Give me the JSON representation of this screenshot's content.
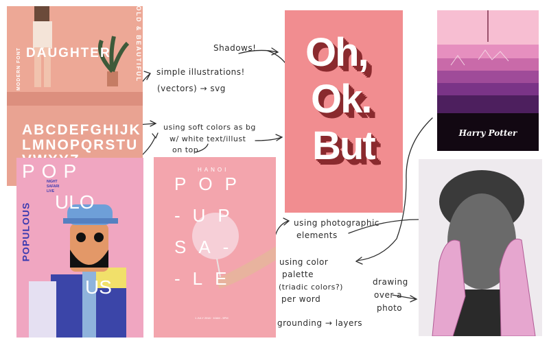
{
  "cards": {
    "daughter": {
      "title": "DAUGHTER",
      "side_left": "MODERN FONT",
      "side_right": "BOLD & BEAUTIFUL",
      "alphabet": "ABCDEFGHIJKLMNOPQRSTUVWXYZ"
    },
    "populous": {
      "top": "POP",
      "middle": "ULO",
      "bottom": "US",
      "name": "POPULOUS",
      "small1": "NIGHT",
      "small2": "SAFARI",
      "small3": "LIVE"
    },
    "hanoi": {
      "city": "HANOI",
      "line1": "POP",
      "line2": "-UP",
      "line3": "SA-",
      "line4": "-LE",
      "footer": "1 JULY 2018 · 10AM - 5PM"
    },
    "ohok": {
      "line1": "Oh,",
      "line2": "Ok.",
      "line3": "But"
    },
    "harry_potter": {
      "brand": "Harry Potter"
    }
  },
  "notes": {
    "shadows": "Shadows!",
    "simple1": "simple illustrations!",
    "simple2": "(vectors) → svg",
    "soft1": "using soft colors as bg",
    "soft2": "w/ white text/illust",
    "soft3": "on top",
    "photo1": "using photographic",
    "photo2": "elements",
    "palette1": "using color",
    "palette2": "palette",
    "palette3": "(triadic colors?)",
    "palette4": "per word",
    "drawing1": "drawing",
    "drawing2": "over a",
    "drawing3": "photo",
    "grounding": "grounding → layers"
  },
  "colors": {
    "salmon": "#e9a392",
    "pink": "#f0a6c1",
    "rose": "#f3a5ad",
    "coral": "#f18d90",
    "ink": "#2b2b2b",
    "purple": "#3c3bb0"
  }
}
